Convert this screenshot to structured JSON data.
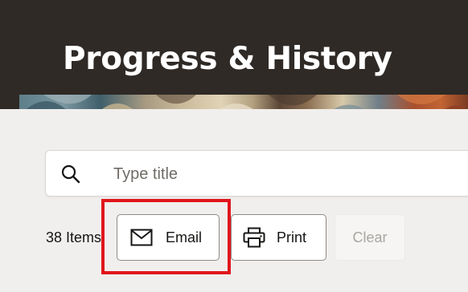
{
  "header": {
    "title": "Progress & History",
    "background_color": "#2f2a26"
  },
  "search": {
    "placeholder": "Type title",
    "value": "",
    "icon": "search-icon"
  },
  "toolbar": {
    "item_count": "38 Items",
    "email_label": "Email",
    "email_icon": "envelope-icon",
    "print_label": "Print",
    "print_icon": "printer-icon",
    "clear_label": "Clear",
    "clear_disabled": true
  },
  "annotation": {
    "highlight_target": "email-button",
    "highlight_color": "#e0161c"
  }
}
